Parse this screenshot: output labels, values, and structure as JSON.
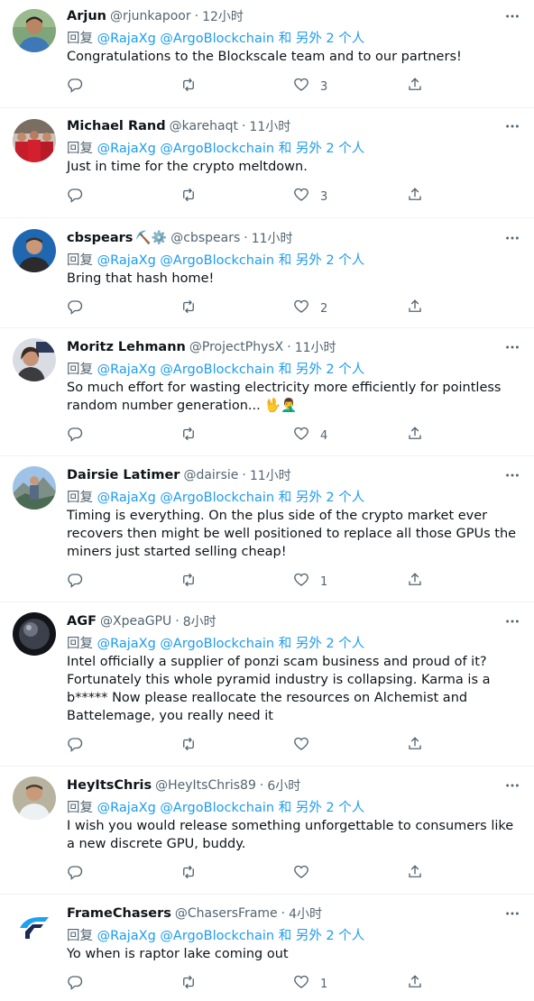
{
  "reply_prefix": "回复",
  "reply_to": [
    "@RajaXg",
    "@ArgoBlockchain"
  ],
  "reply_suffix": "和 另外 2 个人",
  "accent_color": "#1d9bf0",
  "tweets": [
    {
      "name": "Arjun",
      "handle": "@rjunkapoor",
      "time": "12小时",
      "text": "Congratulations to the Blockscale team and to our partners!",
      "likes": "3",
      "avatar": "person-blue-shirt"
    },
    {
      "name": "Michael Rand",
      "handle": "@karehaqt",
      "time": "11小时",
      "text": "Just in time for the crypto meltdown.",
      "likes": "3",
      "avatar": "group-red-jerseys"
    },
    {
      "name": "cbspears",
      "emoji": "⛏️⚙️",
      "handle": "@cbspears",
      "time": "11小时",
      "text": "Bring that hash home!",
      "likes": "2",
      "avatar": "person-blue-background"
    },
    {
      "name": "Moritz Lehmann",
      "handle": "@ProjectPhysX",
      "time": "11小时",
      "text": "So much effort for wasting electricity more efficiently for pointless random number generation... 🖖🤦‍♂️",
      "likes": "4",
      "avatar": "person-with-flag"
    },
    {
      "name": "Dairsie Latimer",
      "handle": "@dairsie",
      "time": "11小时",
      "text": "Timing is everything. On the plus side of the crypto market ever recovers then might be well positioned to replace all those GPUs the miners just started selling cheap!",
      "likes": "1",
      "avatar": "person-mountains"
    },
    {
      "name": "AGF",
      "handle": "@XpeaGPU",
      "time": "8小时",
      "text": "Intel officially a supplier of ponzi scam business and proud of it? Fortunately this whole pyramid industry is collapsing. Karma is a b***** Now please reallocate the resources on Alchemist and Battelemage, you really need it",
      "likes": "",
      "avatar": "dark-sphere"
    },
    {
      "name": "HeyItsChris",
      "handle": "@HeyItsChris89",
      "time": "6小时",
      "text": "I wish you would release something unforgettable to consumers like a new discrete GPU, buddy.",
      "likes": "",
      "avatar": "person-white-shirt"
    },
    {
      "name": "FrameChasers",
      "handle": "@ChasersFrame",
      "time": "4小时",
      "text": "Yo when is raptor lake coming out",
      "likes": "1",
      "avatar": "framechasers-logo"
    }
  ]
}
